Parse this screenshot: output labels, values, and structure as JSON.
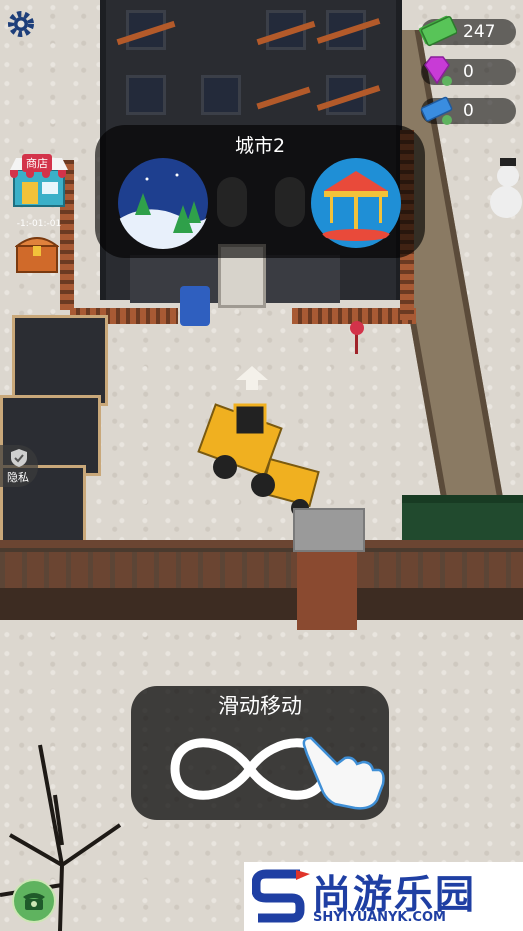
{
  "hud": {
    "cash": "247",
    "gems": "0",
    "tickets": "0"
  },
  "city_panel": {
    "title": "城市2"
  },
  "shop": {
    "label": "商店",
    "timer": "-1:-01:-01"
  },
  "privacy": {
    "label": "隐私"
  },
  "tutorial": {
    "label": "滑动移动"
  },
  "branding": {
    "name": "尚游乐园",
    "url": "SHYIYUANYK.COM"
  },
  "colors": {
    "panel_bg": "#000000",
    "cash_green": "#3fae3f",
    "gem_purple": "#c83bd6",
    "ticket_blue": "#3a8de0",
    "brand_blue": "#1f3fa3",
    "shop_red": "#d3334a"
  },
  "icons": [
    "gear-icon",
    "cash-icon",
    "gem-icon",
    "ticket-icon",
    "shop-icon",
    "chest-icon",
    "shield-icon",
    "phone-icon",
    "hand-pointer-icon",
    "infinity-icon",
    "winter-forest-icon",
    "carousel-icon",
    "arrow-up-icon"
  ]
}
